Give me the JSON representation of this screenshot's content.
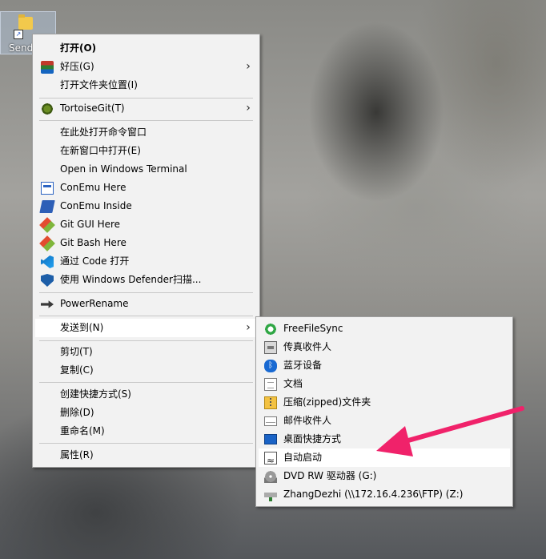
{
  "desktop": {
    "icon_label": "Send"
  },
  "context_menu": {
    "items": [
      {
        "label": "打开(O)",
        "icon": ""
      },
      {
        "label": "好压(G)",
        "icon": "winrar-icon",
        "submenu": true
      },
      {
        "label": "打开文件夹位置(I)",
        "icon": ""
      },
      {
        "label": "TortoiseGit(T)",
        "icon": "tortoisegit-icon",
        "submenu": true
      },
      {
        "label": "在此处打开命令窗口",
        "icon": ""
      },
      {
        "label": "在新窗口中打开(E)",
        "icon": ""
      },
      {
        "label": "Open in Windows Terminal",
        "icon": ""
      },
      {
        "label": "ConEmu Here",
        "icon": "conemu-icon"
      },
      {
        "label": "ConEmu Inside",
        "icon": "powershell-icon"
      },
      {
        "label": "Git GUI Here",
        "icon": "git-icon"
      },
      {
        "label": "Git Bash Here",
        "icon": "git-icon"
      },
      {
        "label": "通过 Code 打开",
        "icon": "vscode-icon"
      },
      {
        "label": "使用 Windows Defender扫描...",
        "icon": "defender-shield-icon"
      },
      {
        "label": "PowerRename",
        "icon": "powerrename-icon"
      },
      {
        "label": "发送到(N)",
        "icon": "",
        "submenu": true,
        "highlighted": true
      },
      {
        "label": "剪切(T)",
        "icon": ""
      },
      {
        "label": "复制(C)",
        "icon": ""
      },
      {
        "label": "创建快捷方式(S)",
        "icon": ""
      },
      {
        "label": "删除(D)",
        "icon": ""
      },
      {
        "label": "重命名(M)",
        "icon": ""
      },
      {
        "label": "属性(R)",
        "icon": ""
      }
    ]
  },
  "sendto_menu": {
    "items": [
      {
        "label": "FreeFileSync",
        "icon": "freefilesync-icon"
      },
      {
        "label": "传真收件人",
        "icon": "fax-icon"
      },
      {
        "label": "蓝牙设备",
        "icon": "bluetooth-icon"
      },
      {
        "label": "文档",
        "icon": "document-icon"
      },
      {
        "label": "压缩(zipped)文件夹",
        "icon": "zip-folder-icon"
      },
      {
        "label": "邮件收件人",
        "icon": "mail-icon"
      },
      {
        "label": "桌面快捷方式",
        "icon": "desktop-icon"
      },
      {
        "label": "自动启动",
        "icon": "startup-folder-icon",
        "highlighted": true
      },
      {
        "label": "DVD RW 驱动器 (G:)",
        "icon": "dvd-drive-icon"
      },
      {
        "label": "ZhangDezhi (\\\\172.16.4.236\\FTP) (Z:)",
        "icon": "network-drive-icon"
      }
    ]
  },
  "annotation": {
    "arrow_color": "#f0226a"
  }
}
